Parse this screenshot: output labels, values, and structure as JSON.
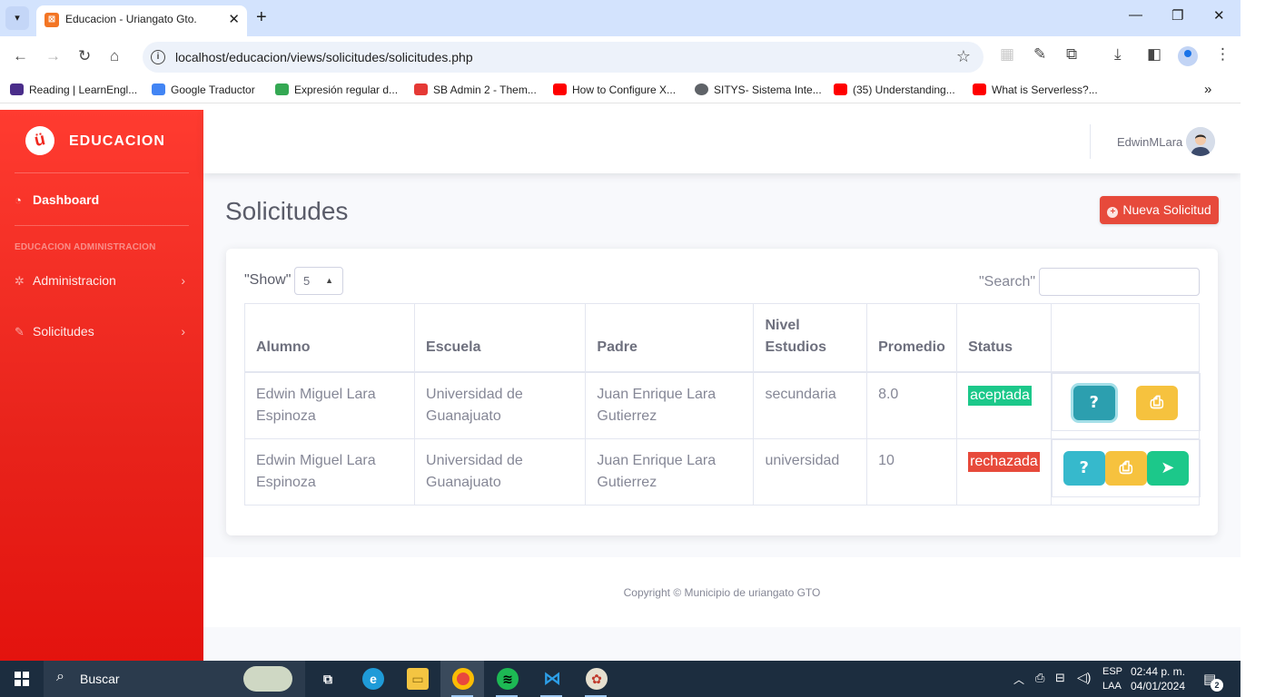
{
  "browser": {
    "tab_title": "Educacion - Uriangato Gto.",
    "url": "localhost/educacion/views/solicitudes/solicitudes.php",
    "bookmarks": [
      {
        "label": "Reading | LearnEngl...",
        "color": "#4a2d8a"
      },
      {
        "label": "Google Traductor",
        "color": "#4285f4"
      },
      {
        "label": "Expresión regular d...",
        "color": "#34a853"
      },
      {
        "label": "SB Admin 2 - Them...",
        "color": "#e53935"
      },
      {
        "label": "How to Configure X...",
        "color": "#ff0000"
      },
      {
        "label": "SITYS- Sistema Inte...",
        "color": "#5f6368"
      },
      {
        "label": "(35) Understanding...",
        "color": "#ff0000"
      },
      {
        "label": "What is Serverless?...",
        "color": "#ff0000"
      }
    ]
  },
  "sidebar": {
    "brand": "EDUCACION",
    "dashboard": "Dashboard",
    "heading": "EDUCACION ADMINISTRACION",
    "items": [
      {
        "label": "Administracion",
        "icon": "gear-icon"
      },
      {
        "label": "Solicitudes",
        "icon": "wrench-icon"
      }
    ]
  },
  "topbar": {
    "username": "EdwinMLara"
  },
  "page": {
    "title": "Solicitudes",
    "new_button": "Nueva Solicitud"
  },
  "datatable": {
    "show_label": "\"Show\"",
    "show_value": "5",
    "search_label": "\"Search\"",
    "columns": [
      "Alumno",
      "Escuela",
      "Padre",
      "Nivel Estudios",
      "Promedio",
      "Status",
      ""
    ],
    "rows": [
      {
        "alumno": "Edwin Miguel Lara Espinoza",
        "escuela": "Universidad de Guanajuato",
        "padre": "Juan Enrique Lara Gutierrez",
        "nivel": "secundaria",
        "promedio": "8.0",
        "status": "aceptada"
      },
      {
        "alumno": "Edwin Miguel Lara Espinoza",
        "escuela": "Universidad de Guanajuato",
        "padre": "Juan Enrique Lara Gutierrez",
        "nivel": "universidad",
        "promedio": "10",
        "status": "rechazada"
      }
    ],
    "action_glyphs": {
      "help": "?",
      "print": "⎙",
      "send": "➤"
    }
  },
  "footer": {
    "copyright": "Copyright © Municipio de uriangato GTO"
  },
  "taskbar": {
    "search_placeholder": "Buscar",
    "lang_top": "ESP",
    "lang_bottom": "LAA",
    "time": "02:44 p. m.",
    "date": "04/01/2024",
    "notifications": "2"
  },
  "colors": {
    "primary_red": "#e74a3b",
    "success": "#1cc88a",
    "info": "#36b9cc",
    "warning": "#f6c23e"
  }
}
